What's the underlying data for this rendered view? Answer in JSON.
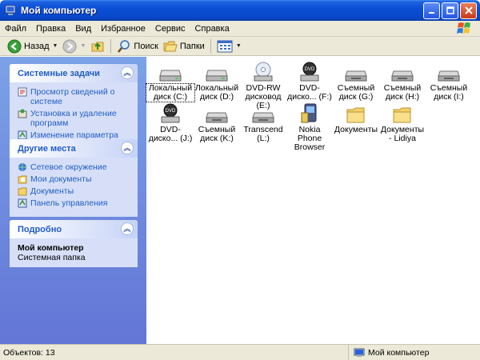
{
  "window": {
    "title": "Мой компьютер"
  },
  "menu": [
    "Файл",
    "Правка",
    "Вид",
    "Избранное",
    "Сервис",
    "Справка"
  ],
  "toolbar": {
    "back": "Назад",
    "search": "Поиск",
    "folders": "Папки"
  },
  "panels": {
    "system": {
      "title": "Системные задачи",
      "items": [
        "Просмотр сведений о системе",
        "Установка и удаление программ",
        "Изменение параметра"
      ]
    },
    "places": {
      "title": "Другие места",
      "items": [
        "Сетевое окружение",
        "Мои документы",
        "Документы",
        "Панель управления"
      ]
    },
    "details": {
      "title": "Подробно",
      "name": "Мой компьютер",
      "type": "Системная папка"
    }
  },
  "items": [
    {
      "label": "Локальный диск (C:)",
      "icon": "hard-drive-icon"
    },
    {
      "label": "Локальный диск (D:)",
      "icon": "hard-drive-icon"
    },
    {
      "label": "DVD-RW дисковод (E:)",
      "icon": "dvd-rw-icon"
    },
    {
      "label": "DVD-диско... (F:)",
      "icon": "dvd-drive-icon"
    },
    {
      "label": "Съемный диск (G:)",
      "icon": "removable-drive-icon"
    },
    {
      "label": "Съемный диск (H:)",
      "icon": "removable-drive-icon"
    },
    {
      "label": "Съемный диск (I:)",
      "icon": "removable-drive-icon"
    },
    {
      "label": "DVD-диско... (J:)",
      "icon": "dvd-drive-icon"
    },
    {
      "label": "Съемный диск (K:)",
      "icon": "removable-drive-icon"
    },
    {
      "label": "Transcend (L:)",
      "icon": "removable-drive-icon"
    },
    {
      "label": "Nokia Phone Browser",
      "icon": "phone-browser-icon"
    },
    {
      "label": "Документы",
      "icon": "folder-icon"
    },
    {
      "label": "Документы - Lidiya",
      "icon": "folder-icon"
    }
  ],
  "status": {
    "count": "Объектов: 13",
    "location": "Мой компьютер"
  }
}
